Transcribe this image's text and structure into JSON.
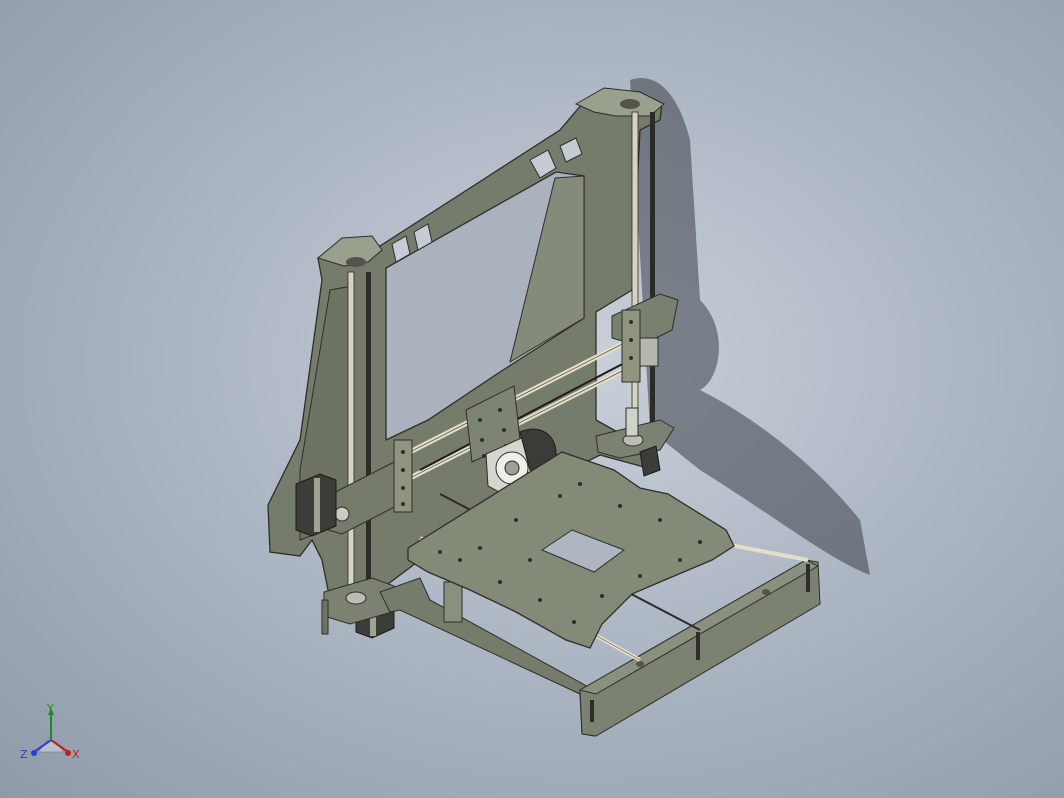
{
  "viewport": {
    "background_center": "#c9d0da",
    "background_edge": "#8f9aa9",
    "model_color": "#6f7566",
    "model_edge_color": "#2c2f28"
  },
  "model": {
    "subject": "3d-printer-frame",
    "icons": [
      "stepper-motor-icon",
      "extruder-fan-icon",
      "heated-bed-icon"
    ]
  },
  "triad": {
    "x_label": "X",
    "y_label": "Y",
    "z_label": "Z",
    "x_color": "#c21f1f",
    "y_color": "#1f8a1f",
    "z_color": "#2b3fcf"
  }
}
